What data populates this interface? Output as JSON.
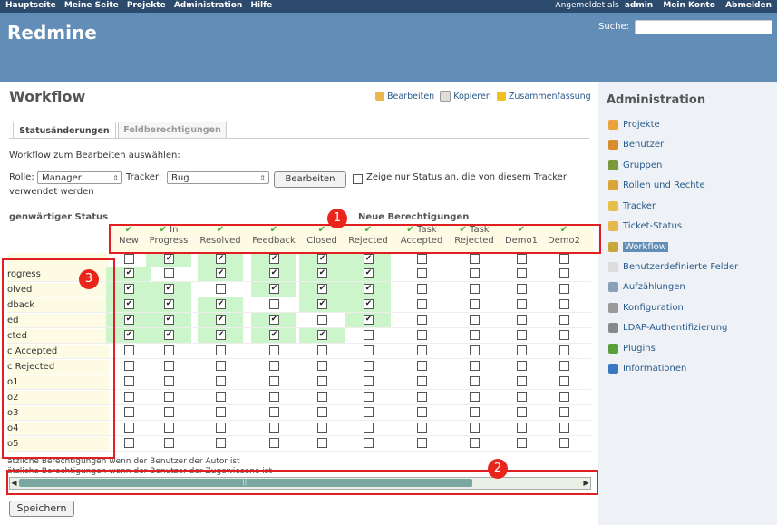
{
  "topbar": {
    "nav": [
      "Hauptseite",
      "Meine Seite",
      "Projekte",
      "Administration",
      "Hilfe"
    ],
    "logged_in_prefix": "Angemeldet als",
    "user": "admin",
    "account": "Mein Konto",
    "logout": "Abmelden"
  },
  "header": {
    "brand": "Redmine",
    "search_label": "Suche:"
  },
  "page": {
    "title": "Workflow"
  },
  "actions": {
    "edit": "Bearbeiten",
    "copy": "Kopieren",
    "summary": "Zusammenfassung"
  },
  "tabs": [
    {
      "label": "Statusänderungen"
    },
    {
      "label": "Feldberechtigungen"
    }
  ],
  "hint": "Workflow zum Bearbeiten auswählen:",
  "filter": {
    "role_label": "Rolle:",
    "role_value": "Manager",
    "tracker_label": "Tracker:",
    "tracker_value": "Bug",
    "edit_button": "Bearbeiten",
    "only_status_line1": "Zeige nur Status an, die von diesem Tracker",
    "only_status_line2": "verwendet werden"
  },
  "table": {
    "current_status_label": "genwärtiger Status",
    "new_permissions_label": "Neue Berechtigungen",
    "columns": [
      [
        "New"
      ],
      [
        "In",
        "Progress"
      ],
      [
        "Resolved"
      ],
      [
        "Feedback"
      ],
      [
        "Closed"
      ],
      [
        "Rejected"
      ],
      [
        "Task",
        "Accepted"
      ],
      [
        "Task",
        "Rejected"
      ],
      [
        "Demo1"
      ],
      [
        "Demo2"
      ]
    ],
    "rows": [
      {
        "label": "",
        "checks": [
          0,
          1,
          1,
          1,
          1,
          1,
          0,
          0,
          0,
          0
        ]
      },
      {
        "label": "rogress",
        "checks": [
          1,
          0,
          1,
          1,
          1,
          1,
          0,
          0,
          0,
          0
        ]
      },
      {
        "label": "olved",
        "checks": [
          1,
          1,
          0,
          1,
          1,
          1,
          0,
          0,
          0,
          0
        ]
      },
      {
        "label": "dback",
        "checks": [
          1,
          1,
          1,
          0,
          1,
          1,
          0,
          0,
          0,
          0
        ]
      },
      {
        "label": "ed",
        "checks": [
          1,
          1,
          1,
          1,
          0,
          1,
          0,
          0,
          0,
          0
        ]
      },
      {
        "label": "cted",
        "checks": [
          1,
          1,
          1,
          1,
          1,
          0,
          0,
          0,
          0,
          0
        ]
      },
      {
        "label": "c Accepted",
        "checks": [
          0,
          0,
          0,
          0,
          0,
          0,
          0,
          0,
          0,
          0
        ]
      },
      {
        "label": "c Rejected",
        "checks": [
          0,
          0,
          0,
          0,
          0,
          0,
          0,
          0,
          0,
          0
        ]
      },
      {
        "label": "o1",
        "checks": [
          0,
          0,
          0,
          0,
          0,
          0,
          0,
          0,
          0,
          0
        ]
      },
      {
        "label": "o2",
        "checks": [
          0,
          0,
          0,
          0,
          0,
          0,
          0,
          0,
          0,
          0
        ]
      },
      {
        "label": "o3",
        "checks": [
          0,
          0,
          0,
          0,
          0,
          0,
          0,
          0,
          0,
          0
        ]
      },
      {
        "label": "o4",
        "checks": [
          0,
          0,
          0,
          0,
          0,
          0,
          0,
          0,
          0,
          0
        ]
      },
      {
        "label": "o5",
        "checks": [
          0,
          0,
          0,
          0,
          0,
          0,
          0,
          0,
          0,
          0
        ]
      }
    ],
    "footer1": "ätzliche Berechtigungen wenn der Benutzer der Autor ist",
    "footer2": "ätzliche Berechtigungen wenn der Benutzer der Zugewiesene ist"
  },
  "save_button": "Speichern",
  "sidebar": {
    "title": "Administration",
    "items": [
      {
        "label": "Projekte",
        "icon": "projects-icon",
        "color": "#e8a33a"
      },
      {
        "label": "Benutzer",
        "icon": "user-icon",
        "color": "#d98c2b"
      },
      {
        "label": "Gruppen",
        "icon": "group-icon",
        "color": "#7a9a3c"
      },
      {
        "label": "Rollen und Rechte",
        "icon": "roles-icon",
        "color": "#d9a53a"
      },
      {
        "label": "Tracker",
        "icon": "tracker-icon",
        "color": "#e6c04d"
      },
      {
        "label": "Ticket-Status",
        "icon": "ticket-status-icon",
        "color": "#e6b84d"
      },
      {
        "label": "Workflow",
        "icon": "workflow-icon",
        "color": "#c9a63a"
      },
      {
        "label": "Benutzerdefinierte Felder",
        "icon": "custom-fields-icon",
        "color": "#dcdcdc"
      },
      {
        "label": "Aufzählungen",
        "icon": "list-icon",
        "color": "#8aa0b8"
      },
      {
        "label": "Konfiguration",
        "icon": "settings-icon",
        "color": "#999999"
      },
      {
        "label": "LDAP-Authentifizierung",
        "icon": "ldap-icon",
        "color": "#888888"
      },
      {
        "label": "Plugins",
        "icon": "plugin-icon",
        "color": "#5aa03a"
      },
      {
        "label": "Informationen",
        "icon": "info-icon",
        "color": "#3a78c2"
      }
    ]
  },
  "annotations": [
    "1",
    "2",
    "3"
  ]
}
